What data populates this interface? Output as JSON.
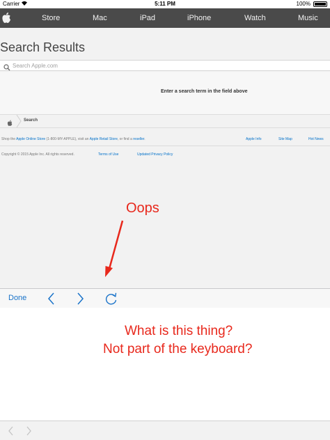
{
  "status_bar": {
    "carrier": "Carrier",
    "time": "5:11 PM",
    "battery": "100%"
  },
  "global_nav": {
    "items": [
      {
        "label": "Store"
      },
      {
        "label": "Mac"
      },
      {
        "label": "iPad"
      },
      {
        "label": "iPhone"
      },
      {
        "label": "Watch"
      },
      {
        "label": "Music"
      }
    ]
  },
  "page": {
    "title": "Search Results",
    "search_placeholder": "Search Apple.com",
    "empty_message": "Enter a search term in the field above",
    "breadcrumb_label": "Search"
  },
  "footer": {
    "shop_prefix": "Shop the ",
    "online_store": "Apple Online Store",
    "phone": " (1-800-MY-APPLE), visit an ",
    "retail_store": "Apple Retail Store",
    "or_find": ", or find a ",
    "reseller": "reseller",
    "period": ".",
    "right_links": [
      "Apple Info",
      "Site Map",
      "Hot News"
    ],
    "copyright": "Copyright © 2015 Apple Inc. All rights reserved.",
    "terms": "Terms of Use",
    "privacy": "Updated Privacy Policy"
  },
  "annotations": {
    "oops": "Oops",
    "question_line1": "What is this thing?",
    "question_line2": "Not part of the keyboard?"
  },
  "toolbar": {
    "done_label": "Done"
  },
  "colors": {
    "nav_bg": "#4a4a4a",
    "link": "#0070c9",
    "annotation": "#e8281c",
    "toolbar_tint": "#1a73c9"
  }
}
